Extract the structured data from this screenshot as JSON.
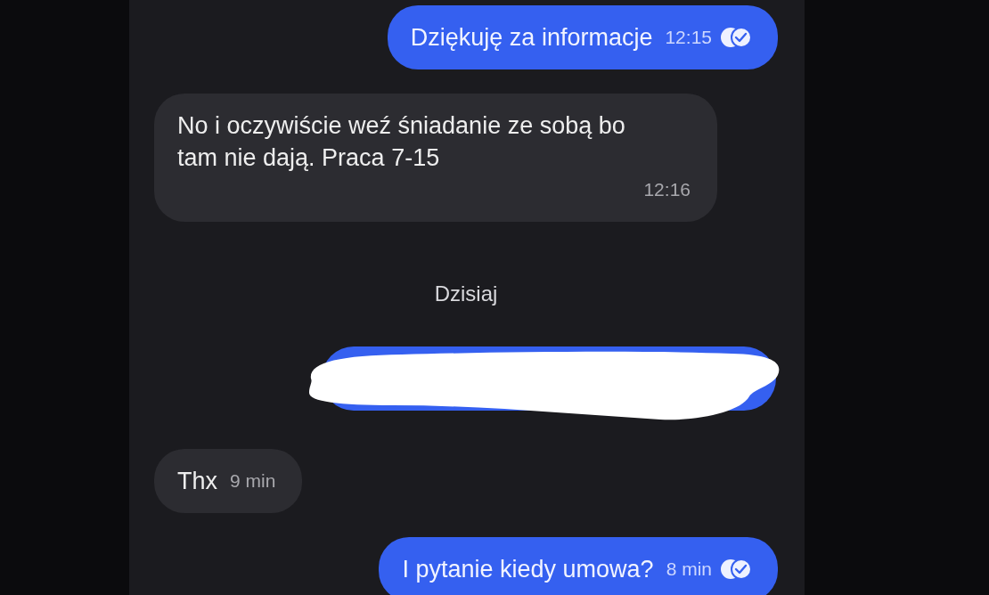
{
  "messages": [
    {
      "kind": "sent",
      "text": "Dziękuję za informacje",
      "time": "12:15",
      "read": true
    },
    {
      "kind": "received",
      "text": "No i oczywiście weź śniadanie ze sobą bo tam nie dają. Praca 7-15",
      "time": "12:16"
    },
    {
      "kind": "date",
      "text": "Dzisiaj"
    },
    {
      "kind": "redacted"
    },
    {
      "kind": "received",
      "text": "Thx",
      "time": "9 min"
    },
    {
      "kind": "sent",
      "text": "I pytanie kiedy umowa?",
      "time": "8 min",
      "read": true
    }
  ]
}
